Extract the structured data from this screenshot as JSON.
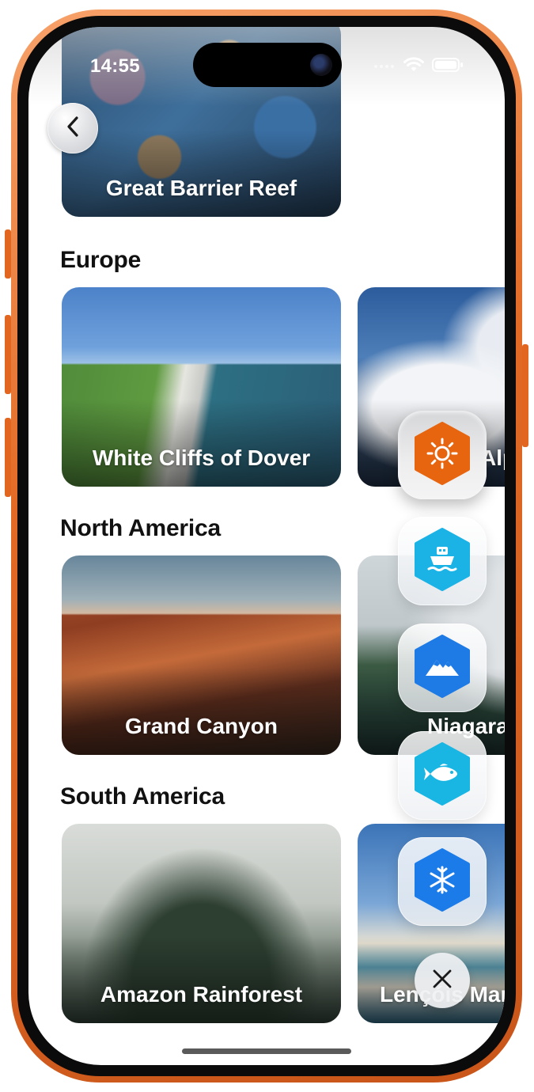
{
  "status": {
    "time": "14:55"
  },
  "featured": {
    "title": "Great Barrier Reef"
  },
  "sections": [
    {
      "title": "Europe",
      "cards": [
        "White Cliffs of Dover",
        "Alps"
      ]
    },
    {
      "title": "North America",
      "cards": [
        "Grand Canyon",
        "Niagara Falls"
      ]
    },
    {
      "title": "South America",
      "cards": [
        "Amazon Rainforest",
        "Lençóis Maranhenses"
      ]
    }
  ],
  "menu": {
    "items": [
      {
        "icon": "sun-icon",
        "color": "#E8650F",
        "active": true
      },
      {
        "icon": "ship-icon",
        "color": "#1BB3E6"
      },
      {
        "icon": "mountain-icon",
        "color": "#1E7BE6"
      },
      {
        "icon": "fish-icon",
        "color": "#19B6E3"
      },
      {
        "icon": "snowflake-icon",
        "color": "#1B7BE8"
      }
    ]
  },
  "colors": {
    "frame": "#E2661F",
    "text": "#111111"
  }
}
